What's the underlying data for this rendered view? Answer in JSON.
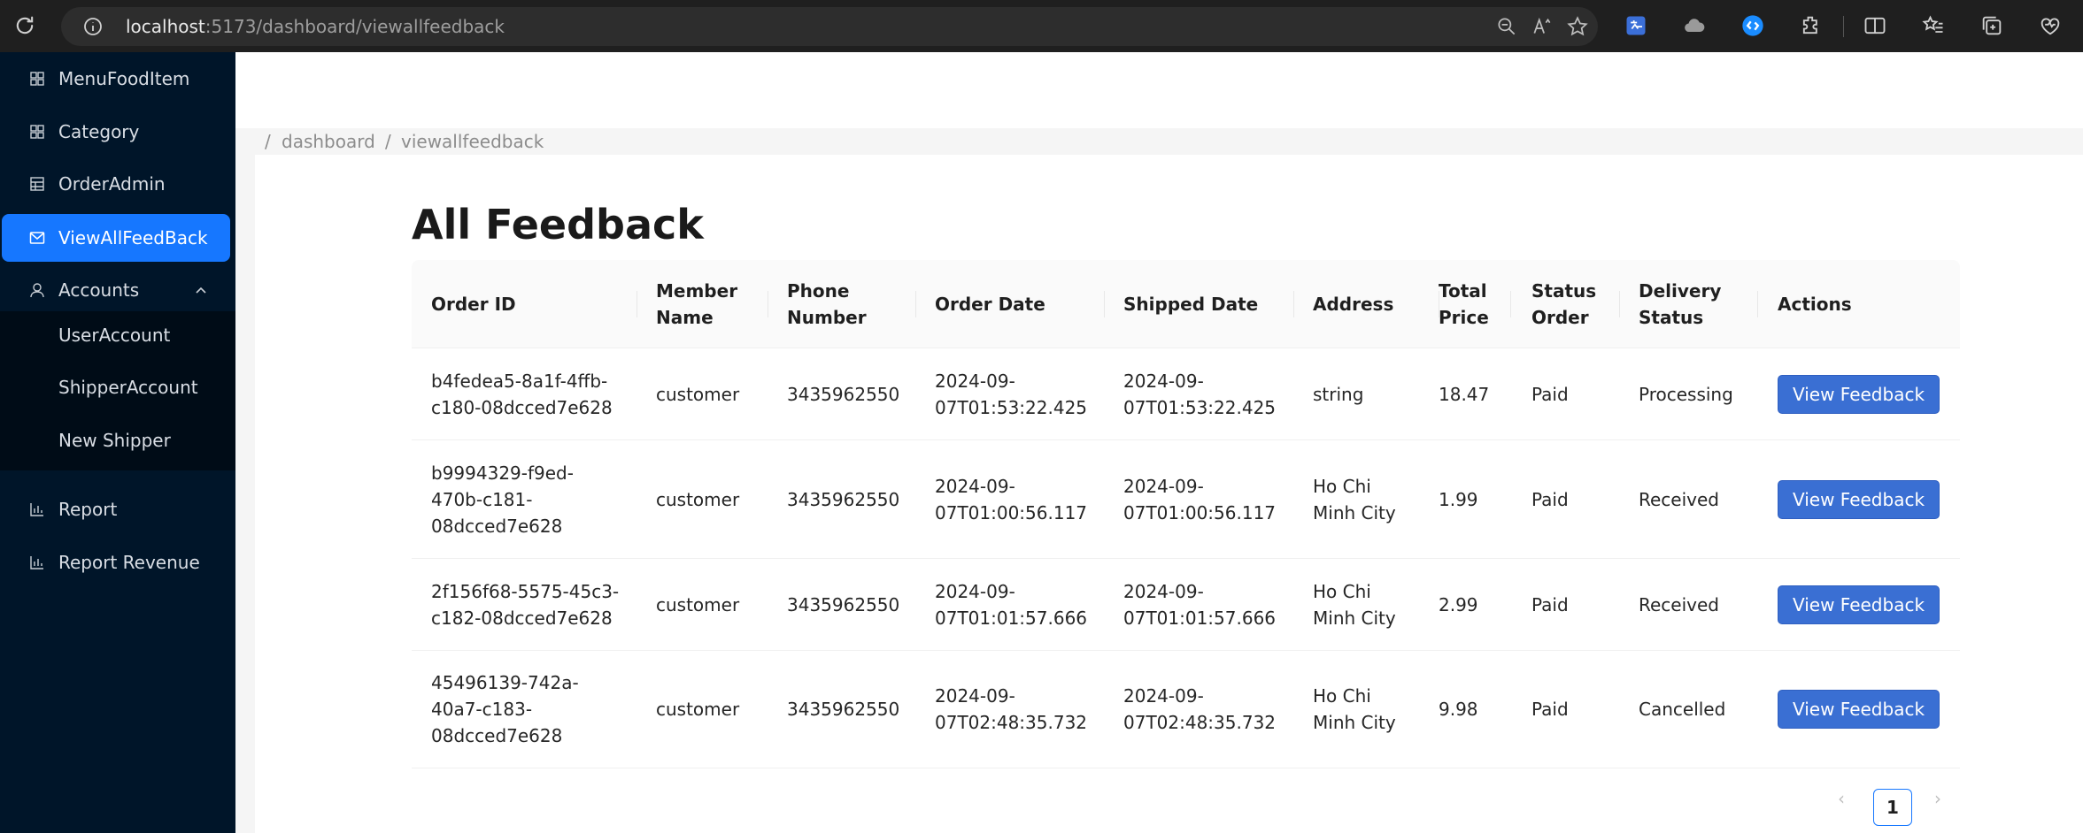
{
  "browser": {
    "url_host": "localhost",
    "url_rest": ":5173/dashboard/viewallfeedback"
  },
  "sidebar": {
    "items": [
      {
        "label": "MenuFoodItem",
        "icon": "grid-icon"
      },
      {
        "label": "Category",
        "icon": "grid-icon"
      },
      {
        "label": "OrderAdmin",
        "icon": "table-icon"
      },
      {
        "label": "ViewAllFeedBack",
        "icon": "mail-icon",
        "active": true
      },
      {
        "label": "Accounts",
        "icon": "user-icon",
        "expanded": true
      },
      {
        "label": "Report",
        "icon": "bar-chart-icon"
      },
      {
        "label": "Report Revenue",
        "icon": "bar-chart-icon"
      }
    ],
    "subitems": [
      "UserAccount",
      "ShipperAccount",
      "New Shipper"
    ]
  },
  "breadcrumb": {
    "sep": "/",
    "items": [
      "dashboard",
      "viewallfeedback"
    ]
  },
  "page": {
    "title": "All Feedback"
  },
  "table": {
    "headers": [
      [
        "Order ID"
      ],
      [
        "Member",
        "Name"
      ],
      [
        "Phone",
        "Number"
      ],
      [
        "Order Date"
      ],
      [
        "Shipped Date"
      ],
      [
        "Address"
      ],
      [
        "Total",
        "Price"
      ],
      [
        "Status",
        "Order"
      ],
      [
        "Delivery",
        "Status"
      ],
      [
        "Actions"
      ]
    ],
    "rows": [
      {
        "order_id": [
          "b4fedea5-8a1f-4ffb-",
          "c180-08dcced7e628"
        ],
        "member": "customer",
        "phone": "3435962550",
        "order_date": [
          "2024-09-",
          "07T01:53:22.425"
        ],
        "shipped_date": [
          "2024-09-",
          "07T01:53:22.425"
        ],
        "address": [
          "string"
        ],
        "total": "18.47",
        "status": "Paid",
        "delivery": "Processing",
        "action": "View Feedback"
      },
      {
        "order_id": [
          "b9994329-f9ed-",
          "470b-c181-",
          "08dcced7e628"
        ],
        "member": "customer",
        "phone": "3435962550",
        "order_date": [
          "2024-09-",
          "07T01:00:56.117"
        ],
        "shipped_date": [
          "2024-09-",
          "07T01:00:56.117"
        ],
        "address": [
          "Ho Chi",
          "Minh City"
        ],
        "total": "1.99",
        "status": "Paid",
        "delivery": "Received",
        "action": "View Feedback"
      },
      {
        "order_id": [
          "2f156f68-5575-45c3-",
          "c182-08dcced7e628"
        ],
        "member": "customer",
        "phone": "3435962550",
        "order_date": [
          "2024-09-",
          "07T01:01:57.666"
        ],
        "shipped_date": [
          "2024-09-",
          "07T01:01:57.666"
        ],
        "address": [
          "Ho Chi",
          "Minh City"
        ],
        "total": "2.99",
        "status": "Paid",
        "delivery": "Received",
        "action": "View Feedback"
      },
      {
        "order_id": [
          "45496139-742a-",
          "40a7-c183-",
          "08dcced7e628"
        ],
        "member": "customer",
        "phone": "3435962550",
        "order_date": [
          "2024-09-",
          "07T02:48:35.732"
        ],
        "shipped_date": [
          "2024-09-",
          "07T02:48:35.732"
        ],
        "address": [
          "Ho Chi",
          "Minh City"
        ],
        "total": "9.98",
        "status": "Paid",
        "delivery": "Cancelled",
        "action": "View Feedback"
      }
    ]
  },
  "pagination": {
    "current": "1",
    "prev": "‹",
    "next": "›"
  },
  "colors": {
    "sidebar_bg": "#001529",
    "submenu_bg": "#000c17",
    "active_item": "#1677ff",
    "button": "#3a6fd3"
  }
}
